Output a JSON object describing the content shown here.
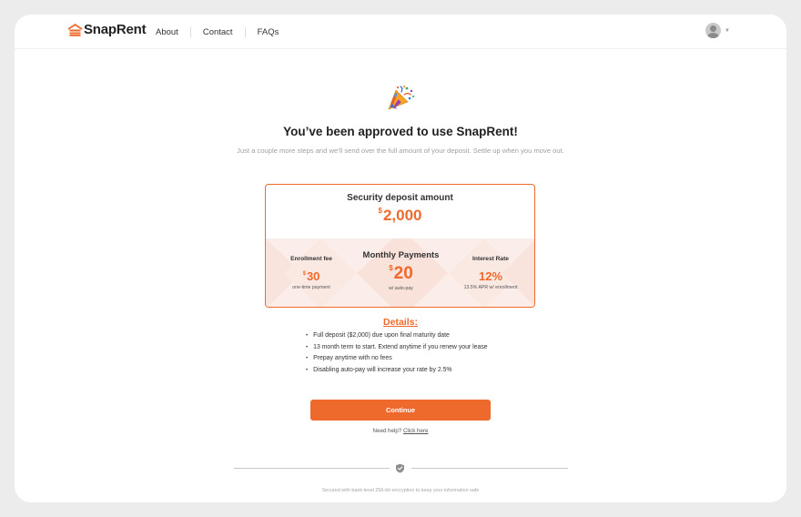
{
  "brand": {
    "name": "SnapRent",
    "accent": "#ee6a2c"
  },
  "nav": {
    "links": [
      {
        "label": "About"
      },
      {
        "label": "Contact"
      },
      {
        "label": "FAQs"
      }
    ],
    "user_icon": "user-avatar-icon",
    "menu_icon": "chevron-down-icon"
  },
  "hero": {
    "icon": "party-popper-icon",
    "title": "You’ve been approved to use SnapRent!",
    "subtitle": "Just a couple more steps and we’ll send over the full amount of your deposit. Settle up when you move out."
  },
  "card": {
    "deposit_label": "Security deposit amount",
    "deposit_currency": "$",
    "deposit_amount": "2,000",
    "enrollment": {
      "label": "Enrollment fee",
      "currency": "$",
      "amount": "30",
      "note": "one-time payment"
    },
    "monthly": {
      "label": "Monthly Payments",
      "currency": "$",
      "amount": "20",
      "note": "w/ auto-pay"
    },
    "interest": {
      "label": "Interest Rate",
      "amount": "12%",
      "note": "13.5% APR w/ enrollment"
    }
  },
  "details": {
    "title": "Details:",
    "items": [
      "Full deposit ($2,000) due upon final maturity date",
      "13 month term to start. Extend anytime if you renew your lease",
      "Prepay anytime with no fees",
      "Disabling auto-pay will increase your rate by 2.5%"
    ]
  },
  "actions": {
    "continue_label": "Continue",
    "help_prefix": "Need help?",
    "help_link": "Click here"
  },
  "footer": {
    "icon": "shield-check-icon",
    "security_text": "Secured with bank-level 256-bit encryption to keep your information safe"
  }
}
